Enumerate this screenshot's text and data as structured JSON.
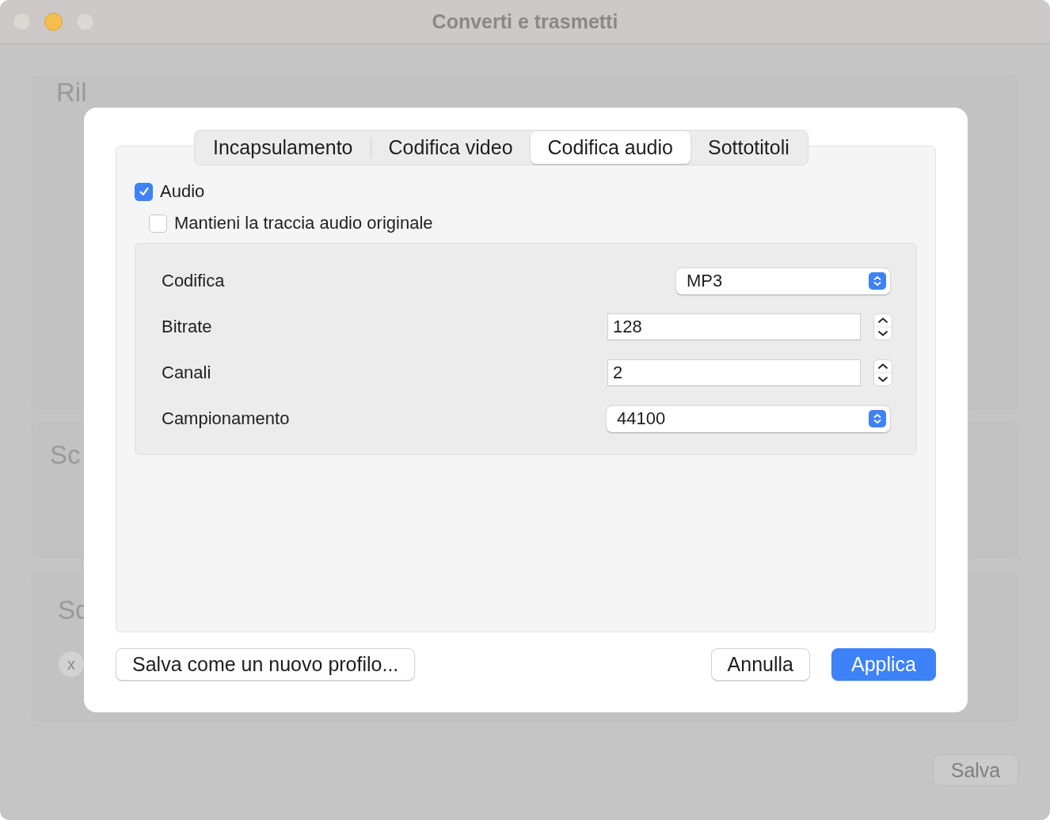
{
  "window": {
    "title": "Converti e trasmetti"
  },
  "background": {
    "drop_area_title": "Ril",
    "section_titles": [
      "Sc",
      "Sc"
    ],
    "remove_button": "x",
    "save_button": "Salva"
  },
  "dialog": {
    "tabs": [
      {
        "label": "Incapsulamento",
        "selected": false
      },
      {
        "label": "Codifica video",
        "selected": false
      },
      {
        "label": "Codifica audio",
        "selected": true
      },
      {
        "label": "Sottotitoli",
        "selected": false
      }
    ],
    "checkboxes": [
      {
        "label": "Audio",
        "checked": true,
        "children": [
          {
            "label": "Mantieni la traccia audio originale",
            "checked": false
          }
        ]
      }
    ],
    "settings": [
      {
        "label": "Codifica",
        "kind": "popup",
        "value": "MP3"
      },
      {
        "label": "Bitrate",
        "kind": "stepper",
        "value": "128"
      },
      {
        "label": "Canali",
        "kind": "stepper",
        "value": "2"
      },
      {
        "label": "Campionamento",
        "kind": "popup",
        "value": "44100"
      }
    ],
    "left_button": "Salva come un nuovo profilo...",
    "buttons": [
      {
        "label": "Annulla",
        "kind": "normal"
      },
      {
        "label": "Applica",
        "kind": "default"
      }
    ]
  }
}
